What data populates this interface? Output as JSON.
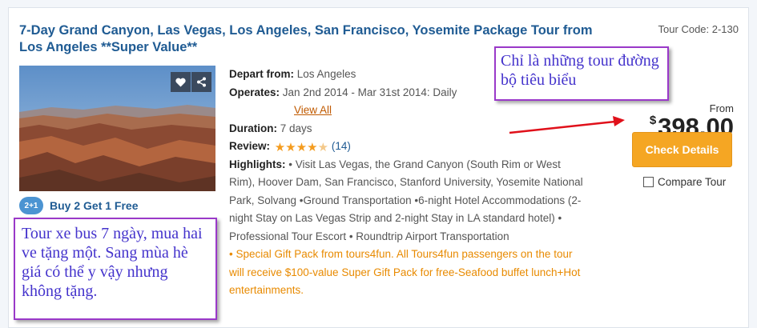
{
  "tour": {
    "title": "7-Day Grand Canyon, Las Vegas, Los Angeles, San Francisco, Yosemite Package Tour from Los Angeles **Super Value**",
    "tour_code": "Tour Code: 2-130"
  },
  "promo": {
    "badge": "2+1",
    "text": "Buy 2 Get 1 Free"
  },
  "details": {
    "depart_label": "Depart from:",
    "depart_value": "Los Angeles",
    "operates_label": "Operates:",
    "operates_value": "Jan 2nd 2014 - Mar 31st 2014: Daily",
    "view_all": "View All",
    "duration_label": "Duration:",
    "duration_value": "7 days",
    "review_label": "Review:",
    "review_rating": 4.5,
    "review_count": "(14)",
    "highlights_label": "Highlights:",
    "highlights_text": "• Visit Las Vegas, the Grand Canyon (South Rim or West Rim), Hoover Dam, San Francisco, Stanford University, Yosemite National Park, Solvang •Ground Transportation •6-night Hotel Accommodations (2-night Stay on Las Vegas Strip and 2-night Stay in LA standard hotel) • Professional Tour Escort • Roundtrip Airport Transportation",
    "gift_text": "• Special Gift Pack from tours4fun. All Tours4fun passengers on the tour will receive $100-value Super Gift Pack for free-Seafood buffet lunch+Hot entertainments."
  },
  "pricing": {
    "from_label": "From",
    "currency": "$",
    "amount": "398.00",
    "check_details": "Check Details",
    "compare_label": "Compare Tour"
  },
  "annotations": {
    "note1": "Chỉ là những tour đường bộ tiêu biểu",
    "note2": "Tour xe bus 7 ngày, mua hai ve tặng một. Sang mùa hè giá có thể y vậy nhưng không tặng."
  },
  "colors": {
    "title": "#1f5b93",
    "button": "#f5a623",
    "gift": "#e88a00",
    "annotation_border": "#9a39c9",
    "annotation_text": "#4433cc",
    "arrow": "#e0101a"
  },
  "icons": [
    "heart-icon",
    "share-icon",
    "star-icon"
  ]
}
